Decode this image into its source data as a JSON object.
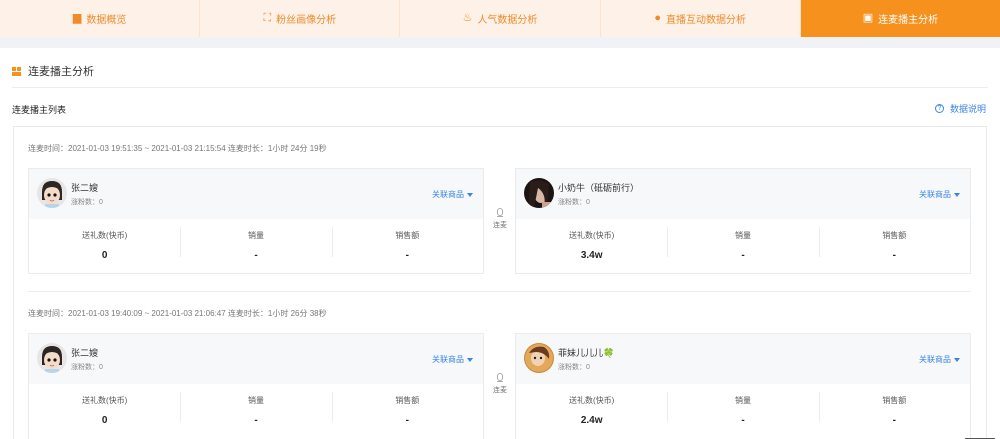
{
  "tabs": [
    {
      "label": "数据概览",
      "icon": "bar-chart-icon",
      "active": false
    },
    {
      "label": "粉丝画像分析",
      "icon": "scan-face-icon",
      "active": false
    },
    {
      "label": "人气数据分析",
      "icon": "flame-icon",
      "active": false
    },
    {
      "label": "直播互动数据分析",
      "icon": "chat-bubble-icon",
      "active": false
    },
    {
      "label": "连麦播主分析",
      "icon": "grid-squares-icon",
      "active": true
    }
  ],
  "section": {
    "title": "连麦播主分析",
    "list_title": "连麦播主列表",
    "data_note": "数据说明",
    "data_note_icon": "question-circle-icon"
  },
  "link_label": "连麦",
  "stat_labels": {
    "gift": "送礼数(快币)",
    "sales": "销量",
    "revenue": "销售额"
  },
  "assoc_label": "关联商品",
  "sessions": [
    {
      "time": "连麦时间：2021-01-03 19:51:35 ~ 2021-01-03 21:15:54 连麦时长：1小时 24分 19秒",
      "left": {
        "name": "张二嫂",
        "fans": "涨粉数：0",
        "gift": "0",
        "sales": "-",
        "revenue": "-"
      },
      "right": {
        "name": "小奶牛（砥砺前行）",
        "fans": "涨粉数：0",
        "gift": "3.4w",
        "sales": "-",
        "revenue": "-"
      }
    },
    {
      "time": "连麦时间：2021-01-03 19:40:09 ~ 2021-01-03 21:06:47 连麦时长：1小时 26分 38秒",
      "left": {
        "name": "张二嫂",
        "fans": "涨粉数：0",
        "gift": "0",
        "sales": "-",
        "revenue": "-"
      },
      "right": {
        "name": "菲妹儿儿儿🍀",
        "fans": "涨粉数：0",
        "gift": "2.4w",
        "sales": "-",
        "revenue": "-"
      }
    }
  ],
  "colors": {
    "accent": "#f7911e",
    "link": "#3a86e6",
    "tab_bg": "#fdf1e8"
  }
}
